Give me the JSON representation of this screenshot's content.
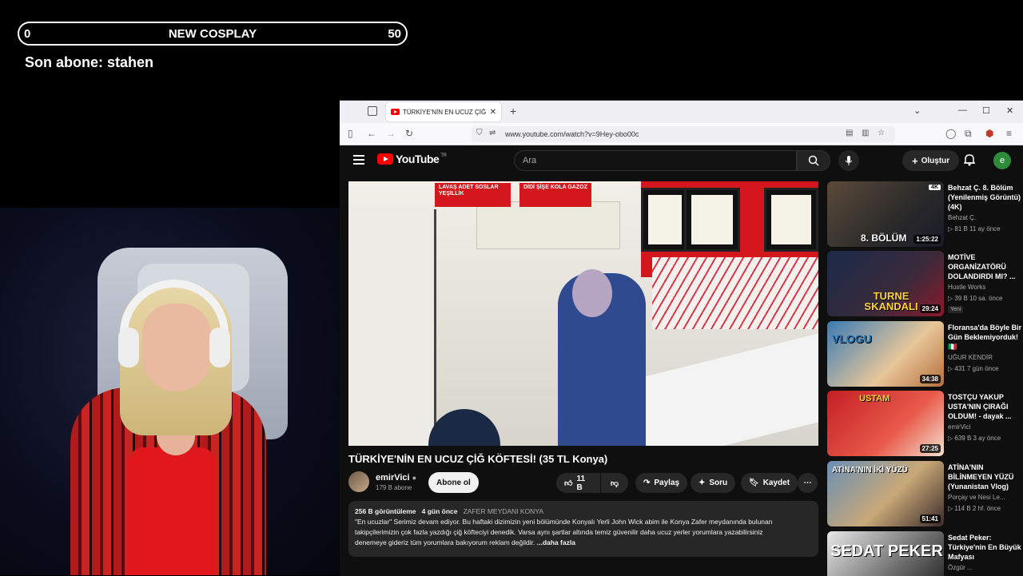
{
  "overlay": {
    "goal_start": "0",
    "goal_title": "NEW COSPLAY",
    "goal_end": "50",
    "last_sub": "Son abone: stahen"
  },
  "browser": {
    "tab_title": "TÜRKİYE'NİN EN UCUZ ÇİĞ KÖF",
    "url": "www.youtube.com/watch?v=9Hey-obo00c"
  },
  "youtube": {
    "logo": "YouTube",
    "region": "TR",
    "search_placeholder": "Ara",
    "create_label": "Oluştur",
    "avatar_letter": "e"
  },
  "video": {
    "signs": [
      "LAVAŞ ADET SOSLAR YEŞİLLİK",
      "DİDİ ŞİŞE KOLA GAZOZ"
    ],
    "title": "TÜRKİYE'NİN EN UCUZ ÇİĞ KÖFTESİ! (35 TL Konya)",
    "channel": "emirVici",
    "subs": "179 B abone",
    "subscribe": "Abone ol",
    "likes": "11 B",
    "share": "Paylaş",
    "ask": "Soru",
    "save": "Kaydet",
    "views": "256 B görüntüleme",
    "age": "4 gün önce",
    "location": "ZAFER MEYDANI KONYA",
    "desc_lines": [
      "\"En ucuzlar\" Serimiz devam ediyor. Bu haftaki dizimizin yeni bölümünde Konyalı Yerli John Wick abim ile Konya Zafer meydanında bulunan",
      "takipçilerimizin çok fazla yazdığı çiğ köfteciyi denedik. Varsa aynı şartlar altında temiz güvenilir daha ucuz yerler yorumlara yazabilirsiniz",
      "denemeye gideriz tüm yorumlara bakıyorum reklam değildir."
    ],
    "more": "...daha fazla"
  },
  "recs": [
    {
      "title": "Behzat Ç. 8. Bölüm (Yenilenmiş Görüntü) (4K)",
      "channel": "Behzat Ç.",
      "meta": "▷ 81 B  11 ay önce",
      "duration": "1:25:22",
      "thumb_text": "8. BÖLÜM",
      "badge": "",
      "corner": "4K"
    },
    {
      "title": "MOTİVE ORGANİZATÖRÜ DOLANDIRDI MI? ...",
      "channel": "Hustle Works",
      "meta": "▷ 39 B  10 sa. önce",
      "duration": "29:24",
      "thumb_text": "TURNE SKANDALI",
      "badge": "Yeni",
      "corner": ""
    },
    {
      "title": "Floransa'da Böyle Bir Gün Beklemiyorduk! 🇮🇹",
      "channel": "UĞUR KENDİR",
      "meta": "▷ 431  7 gün önce",
      "duration": "34:38",
      "thumb_text": "VLOGU",
      "badge": "",
      "corner": ""
    },
    {
      "title": "TOSTÇU YAKUP USTA'NIN ÇIRAĞI OLDUM! - dayak ...",
      "channel": "emirVici",
      "meta": "▷ 639 B  3 ay önce",
      "duration": "27:25",
      "thumb_text": "USTAM",
      "badge": "",
      "corner": ""
    },
    {
      "title": "ATİNA'NIN BİLİNMEYEN YÜZÜ (Yunanistan Vlog)",
      "channel": "Porçay ve Nesi Le...",
      "meta": "▷ 114 B  2 hf. önce",
      "duration": "51:41",
      "thumb_text": "ATİNA'NIN İKİ YÜZÜ",
      "badge": "",
      "corner": ""
    },
    {
      "title": "Sedat Peker: Türkiye'nin En Büyük Mafyası",
      "channel": "Özgür ...",
      "meta": "",
      "duration": "",
      "thumb_text": "SEDAT PEKER",
      "badge": "",
      "corner": ""
    }
  ],
  "colors": {
    "yt_red": "#ff0000",
    "dark_bg": "#0f0f0f",
    "chip": "#272727"
  }
}
